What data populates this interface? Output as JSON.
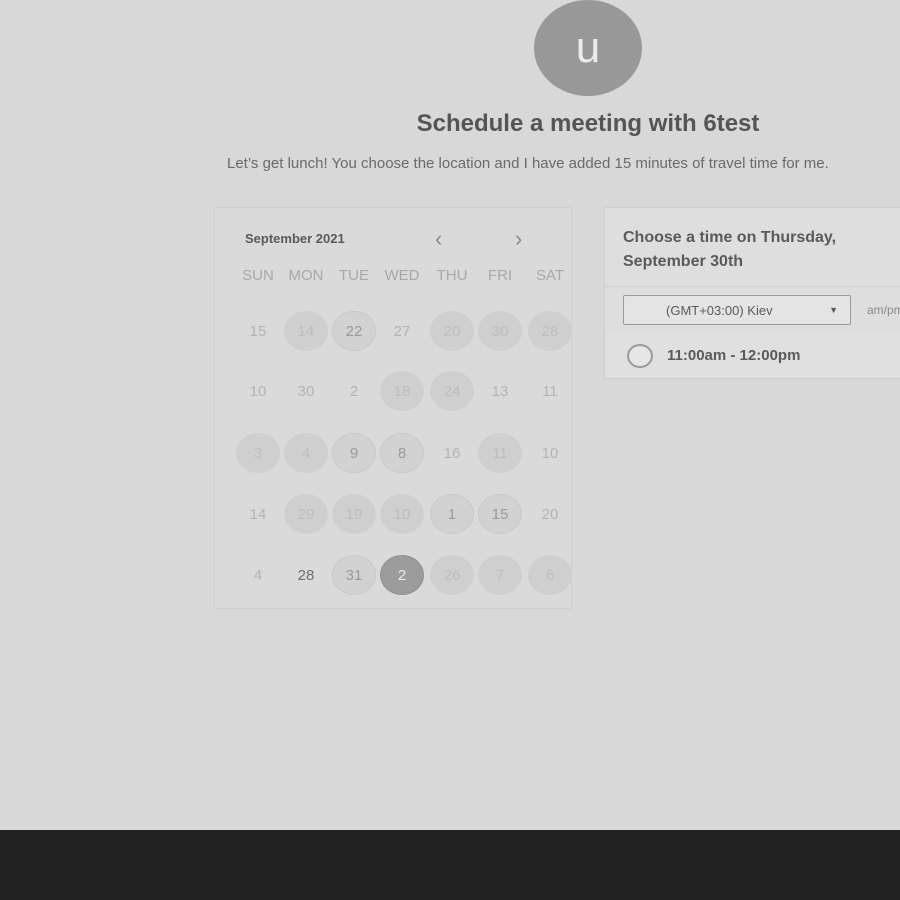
{
  "header": {
    "avatar_letter": "u",
    "title": "Schedule a meeting with 6test",
    "description": "Let’s get lunch! You choose the location and I have added 15 minutes of travel time for me."
  },
  "calendar": {
    "month": "September 2021",
    "prev": "‹",
    "next": "›",
    "weekdays": [
      "SUN",
      "MON",
      "TUE",
      "WED",
      "THU",
      "FRI",
      "SAT"
    ],
    "weeks": [
      [
        "15",
        "14",
        "22",
        "27",
        "20",
        "30",
        "28"
      ],
      [
        "10",
        "30",
        "2",
        "18",
        "24",
        "13",
        "11"
      ],
      [
        "3",
        "4",
        "9",
        "8",
        "16",
        "11",
        "10"
      ],
      [
        "14",
        "29",
        "19",
        "10",
        "1",
        "15",
        "20"
      ],
      [
        "4",
        "28",
        "31",
        "2",
        "26",
        "7",
        "6"
      ]
    ]
  },
  "times": {
    "title": "Choose a time on Thursday, September 30th",
    "timezone": "(GMT+03:00) Kiev",
    "format": "am/pm",
    "slots": [
      "11:00am - 12:00pm"
    ]
  },
  "colors": {
    "background": "#d8d8d8",
    "footer": "#222222",
    "avatar": "#989898",
    "selected_day": "#9c9c9c"
  }
}
